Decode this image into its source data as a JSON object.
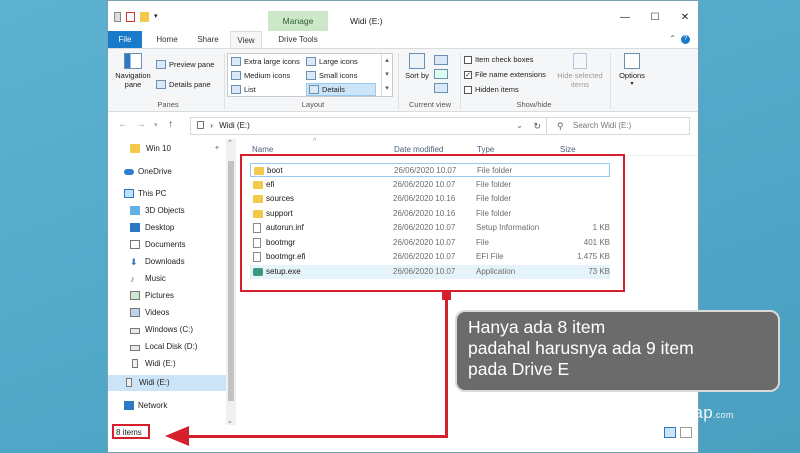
{
  "window": {
    "title": "Widi (E:)",
    "context_tab": "Manage",
    "controls": {
      "minimize": "—",
      "maximize": "☐",
      "close": "✕"
    }
  },
  "tabs": [
    {
      "label": "File"
    },
    {
      "label": "Home"
    },
    {
      "label": "Share"
    },
    {
      "label": "View"
    },
    {
      "label": "Drive Tools"
    }
  ],
  "ribbon": {
    "panes": {
      "navigation_pane": "Navigation pane",
      "preview_pane": "Preview pane",
      "details_pane": "Details pane",
      "group": "Panes"
    },
    "layout": {
      "options": [
        "Extra large icons",
        "Large icons",
        "Medium icons",
        "Small icons",
        "List",
        "Details"
      ],
      "selected": "Details",
      "group": "Layout"
    },
    "current_view": {
      "sort_by": "Sort by",
      "group": "Current view"
    },
    "show_hide": {
      "item_check_boxes": {
        "label": "Item check boxes",
        "checked": false
      },
      "file_name_extensions": {
        "label": "File name extensions",
        "checked": true
      },
      "hidden_items": {
        "label": "Hidden items",
        "checked": false
      },
      "hide_selected": "Hide selected items",
      "group": "Show/hide"
    },
    "options": "Options"
  },
  "address": {
    "path": "Widi (E:)",
    "search_placeholder": "Search Widi (E:)"
  },
  "nav_pane": {
    "items": [
      {
        "label": "Win 10",
        "icon": "folder-icon"
      },
      {
        "label": "OneDrive",
        "icon": "cloud-icon"
      },
      {
        "label": "This PC",
        "icon": "computer-icon"
      },
      {
        "label": "3D Objects",
        "icon": "cube-icon"
      },
      {
        "label": "Desktop",
        "icon": "desktop-icon"
      },
      {
        "label": "Documents",
        "icon": "documents-icon"
      },
      {
        "label": "Downloads",
        "icon": "download-icon"
      },
      {
        "label": "Music",
        "icon": "music-icon"
      },
      {
        "label": "Pictures",
        "icon": "pictures-icon"
      },
      {
        "label": "Videos",
        "icon": "videos-icon"
      },
      {
        "label": "Windows (C:)",
        "icon": "drive-icon"
      },
      {
        "label": "Local Disk (D:)",
        "icon": "drive-icon"
      },
      {
        "label": "Widi (E:)",
        "icon": "usb-drive-icon"
      },
      {
        "label": "Widi (E:)",
        "icon": "usb-drive-icon",
        "selected": true
      },
      {
        "label": "Network",
        "icon": "network-icon"
      }
    ]
  },
  "columns": {
    "name": "Name",
    "date": "Date modified",
    "type": "Type",
    "size": "Size"
  },
  "files": [
    {
      "name": "boot",
      "date": "26/06/2020 10.07",
      "type": "File folder",
      "size": "",
      "icon": "folder-icon"
    },
    {
      "name": "efi",
      "date": "26/06/2020 10.07",
      "type": "File folder",
      "size": "",
      "icon": "folder-icon"
    },
    {
      "name": "sources",
      "date": "26/06/2020 10.16",
      "type": "File folder",
      "size": "",
      "icon": "folder-icon"
    },
    {
      "name": "support",
      "date": "26/06/2020 10.16",
      "type": "File folder",
      "size": "",
      "icon": "folder-icon"
    },
    {
      "name": "autorun.inf",
      "date": "26/06/2020 10.07",
      "type": "Setup Information",
      "size": "1 KB",
      "icon": "file-icon"
    },
    {
      "name": "bootmgr",
      "date": "26/06/2020 10.07",
      "type": "File",
      "size": "401 KB",
      "icon": "file-icon"
    },
    {
      "name": "bootmgr.efi",
      "date": "26/06/2020 10.07",
      "type": "EFI File",
      "size": "1.475 KB",
      "icon": "file-icon"
    },
    {
      "name": "setup.exe",
      "date": "26/06/2020 10.07",
      "type": "Application",
      "size": "73 KB",
      "icon": "setup-exe-icon"
    }
  ],
  "status": {
    "count": "8 items"
  },
  "annotation": {
    "line1": "Hanya ada 8 item",
    "line2": "padahal harusnya ada 9 item",
    "line3": "pada Drive E",
    "colors": {
      "highlight": "#d61f2c",
      "callout_bg": "#6b6b6b"
    }
  },
  "watermark": {
    "brand": "Tutorialengkap",
    "suffix": ".com"
  }
}
